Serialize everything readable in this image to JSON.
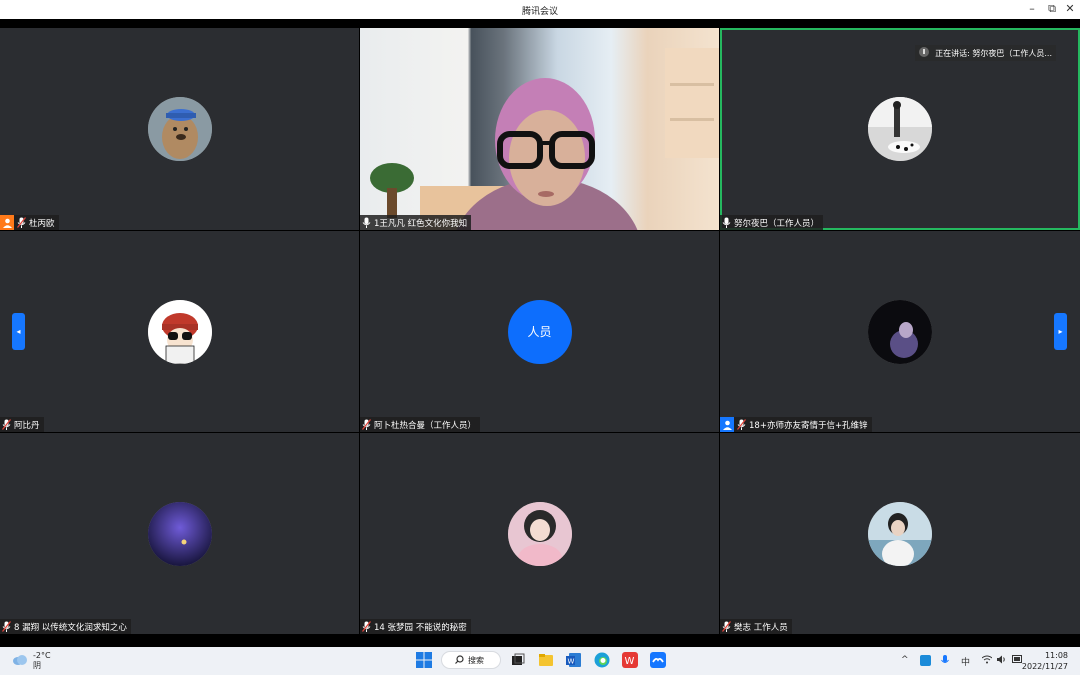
{
  "window": {
    "title": "腾讯会议"
  },
  "speaking": {
    "label": "正在讲话: 努尔夜巴（工作人员..."
  },
  "participants": [
    {
      "name": "杜丙欧",
      "host": "orange"
    },
    {
      "name": "1王凡凡 红色文化你我知",
      "video": true
    },
    {
      "name": "努尔夜巴（工作人员）",
      "speaking": true
    },
    {
      "name": "阿比丹"
    },
    {
      "name": "阿卜杜热合曼（工作人员）",
      "avatar_text": "人员"
    },
    {
      "name": "18+亦师亦友寄情于信+孔维锌",
      "host": "blue"
    },
    {
      "name": "8 漏翔 以传统文化润求知之心"
    },
    {
      "name": "14 张梦园 不能说的秘密"
    },
    {
      "name": "樊志 工作人员"
    }
  ],
  "taskbar": {
    "weather_temp": "-2°C",
    "weather_desc": "阴",
    "search_label": "搜索",
    "ime": "中",
    "time": "11:08",
    "date": "2022/11/27"
  }
}
